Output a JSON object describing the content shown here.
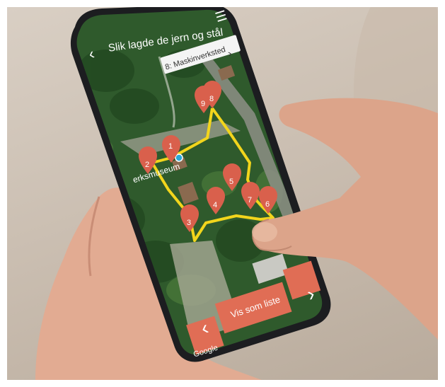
{
  "header": {
    "title": "Slik lagde de jern og stål",
    "back_icon": "chevron-left-icon",
    "menu_icon": "hamburger-menu-icon"
  },
  "station_popup": {
    "label": "8: Maskinverksted",
    "icon": "chevron-right-icon"
  },
  "map": {
    "place_label": "erksmuseum",
    "attribution": "Google",
    "route_color": "#f2d51c",
    "marker_color": "#d9604c",
    "markers": [
      "1",
      "2",
      "3",
      "4",
      "5",
      "6",
      "7",
      "8",
      "9"
    ]
  },
  "bottom_bar": {
    "prev_icon": "chevron-left-icon",
    "list_button": "Vis som liste",
    "next_icon": "chevron-right-icon",
    "button_color": "#e06d55"
  }
}
